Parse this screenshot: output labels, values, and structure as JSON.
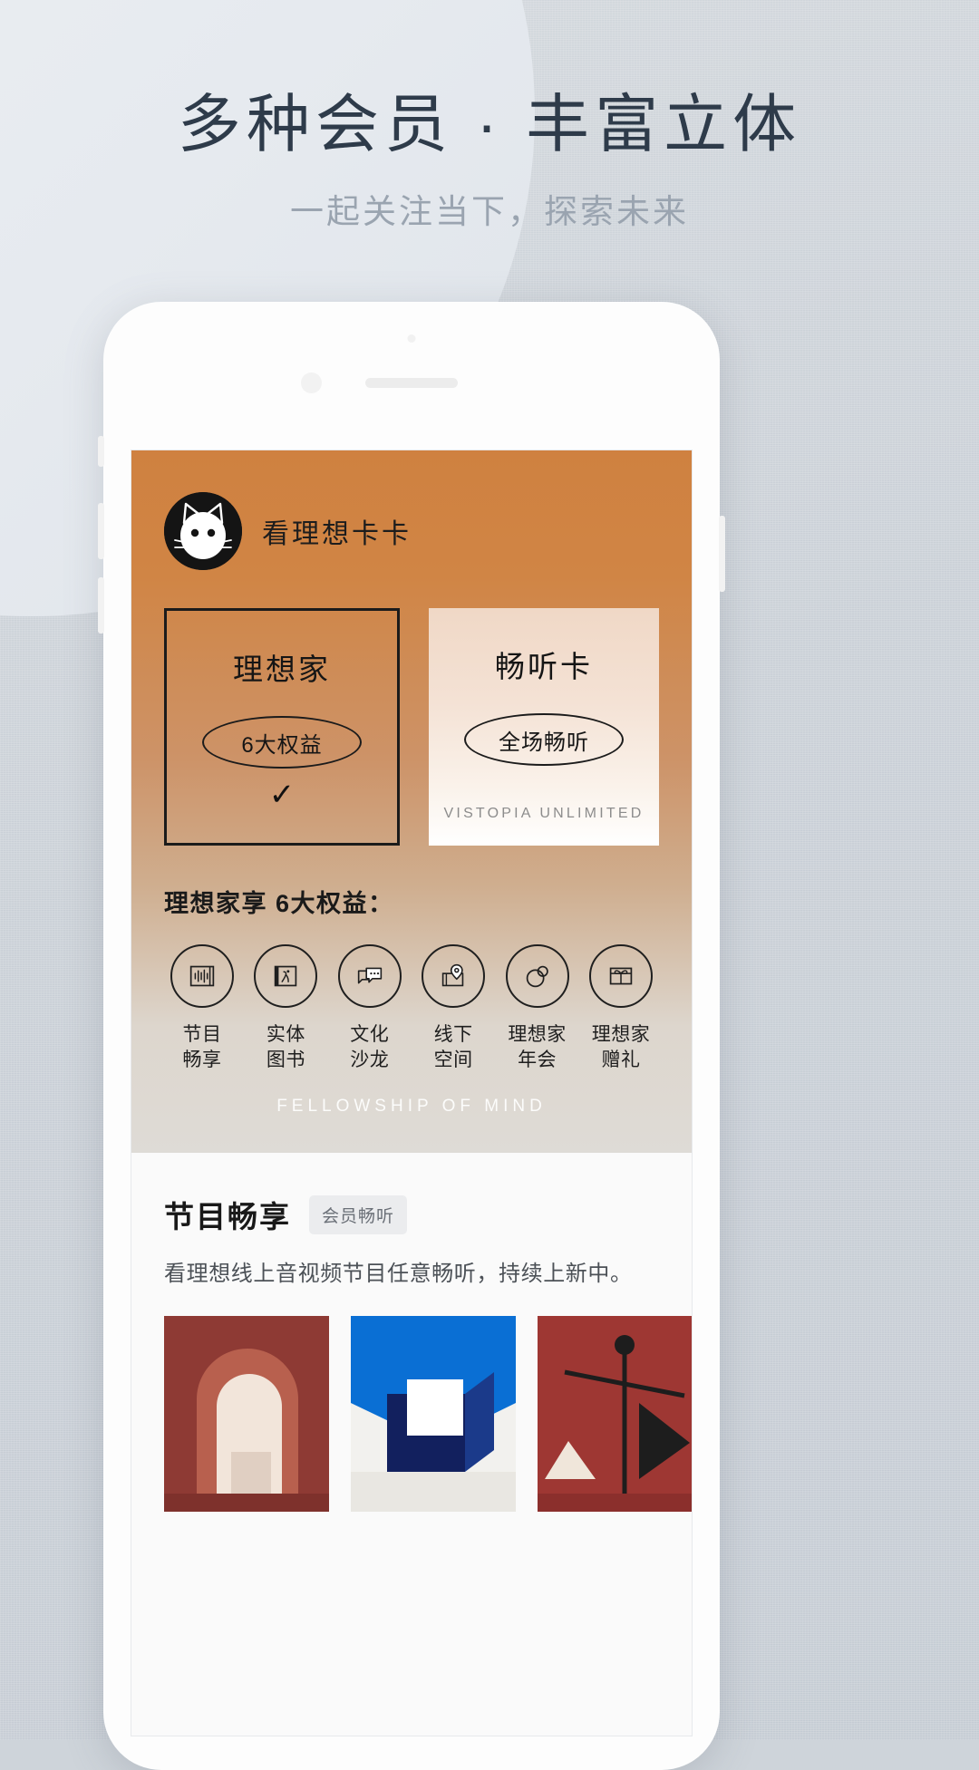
{
  "page": {
    "headline": "多种会员 · 丰富立体",
    "subhead": "一起关注当下，探索未来"
  },
  "colors": {
    "accent_orange": "#cf8140",
    "headline": "#2e3b4a",
    "subhead": "#9aa4b0",
    "ink": "#1b1b1b",
    "badge_bg": "#ebecee"
  },
  "app": {
    "brand": {
      "logo_icon": "cat-logo-icon",
      "name": "看理想卡卡"
    },
    "plans": [
      {
        "title": "理想家",
        "pill": "6大权益",
        "selected": true,
        "check_glyph": "✓",
        "footer": ""
      },
      {
        "title": "畅听卡",
        "pill": "全场畅听",
        "selected": false,
        "check_glyph": "",
        "footer": "VISTOPIA UNLIMITED"
      }
    ],
    "benefits": {
      "title": "理想家享 6大权益：",
      "items": [
        {
          "icon": "audio-waveform-icon",
          "line1": "节目",
          "line2": "畅享"
        },
        {
          "icon": "book-icon",
          "line1": "实体",
          "line2": "图书"
        },
        {
          "icon": "speech-bubbles-icon",
          "line1": "文化",
          "line2": "沙龙"
        },
        {
          "icon": "map-pin-icon",
          "line1": "线下",
          "line2": "空间"
        },
        {
          "icon": "circles-icon",
          "line1": "理想家",
          "line2": "年会"
        },
        {
          "icon": "gift-box-icon",
          "line1": "理想家",
          "line2": "赠礼"
        }
      ]
    },
    "hero_footer": "FELLOWSHIP OF MIND",
    "section": {
      "title": "节目畅享",
      "badge": "会员畅听",
      "description": "看理想线上音视频节目任意畅听，持续上新中。",
      "thumbnails": [
        {
          "name": "doorway-artwork",
          "palette": [
            "#8e3a34",
            "#b85a4a",
            "#f0e2d8"
          ]
        },
        {
          "name": "blue-cube-artwork",
          "palette": [
            "#0a6fd4",
            "#12205e",
            "#f2f2f0"
          ]
        },
        {
          "name": "balance-scale-artwork",
          "palette": [
            "#9e3733",
            "#1d1d1d",
            "#efe7dd"
          ]
        },
        {
          "name": "partial-blue-artwork",
          "palette": [
            "#2b7fd0"
          ]
        }
      ]
    }
  }
}
